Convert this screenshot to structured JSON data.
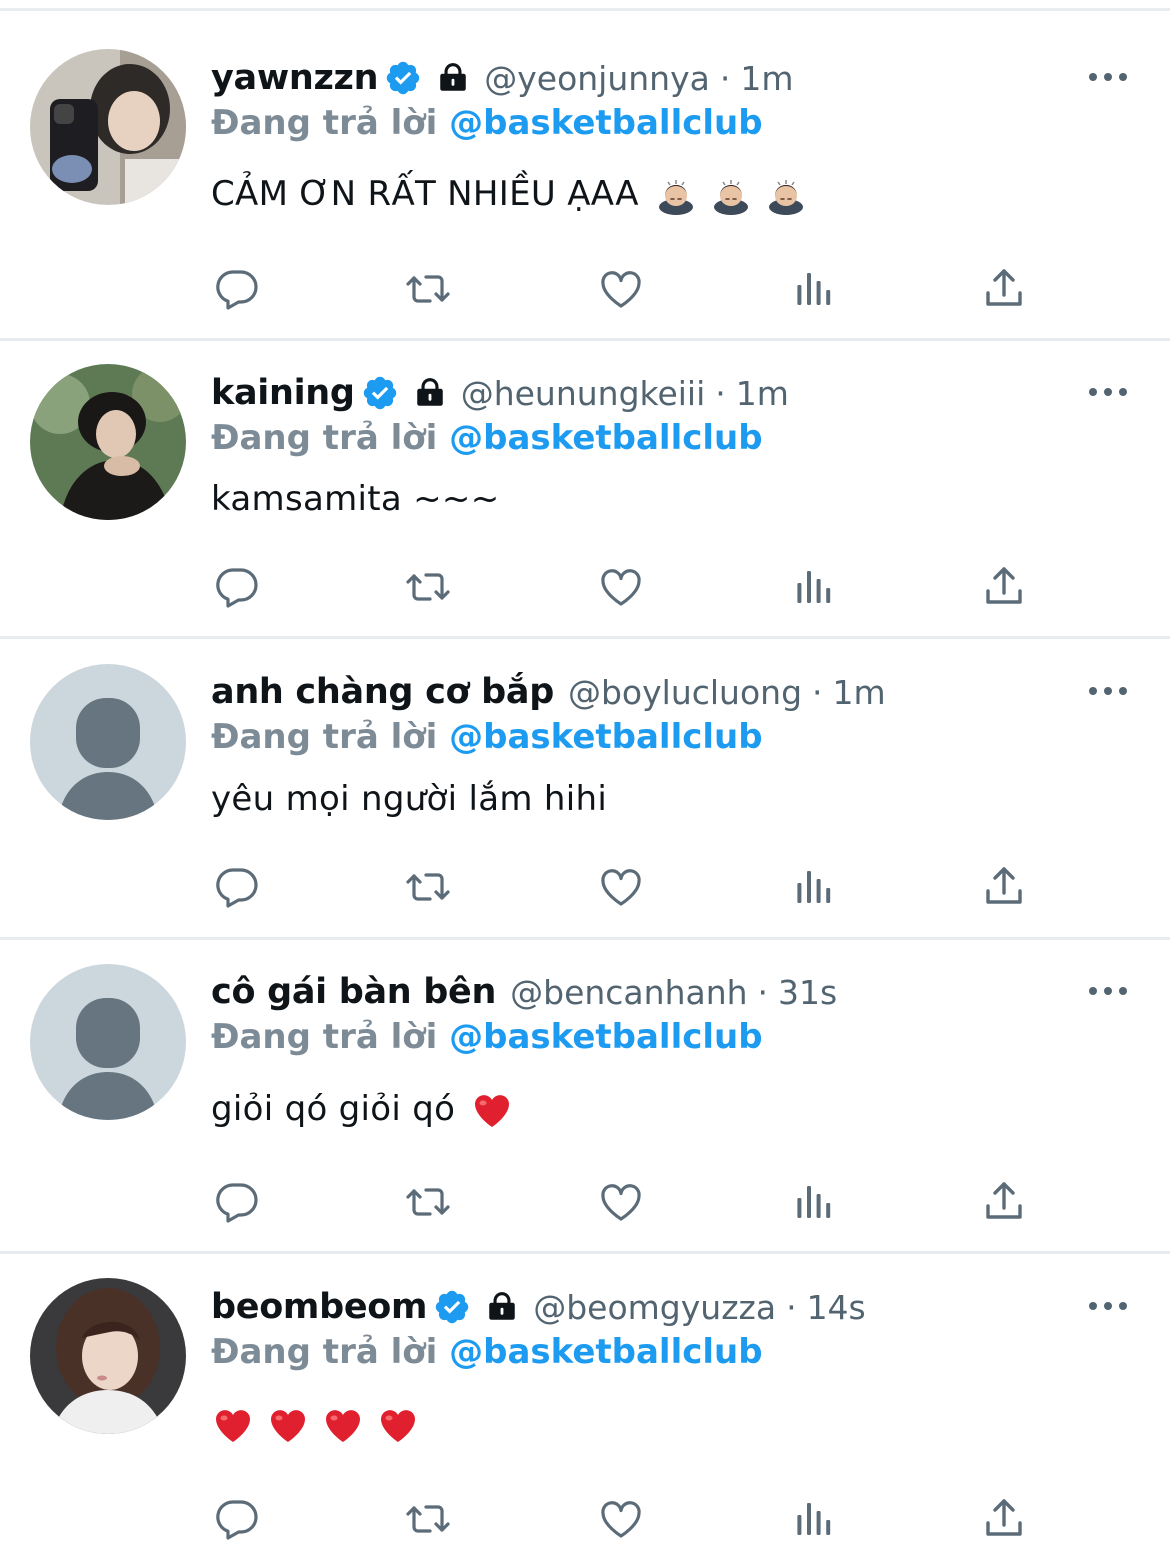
{
  "colors": {
    "verified_blue": "#1d9bf0",
    "mention_blue": "#1d9bf0",
    "muted_gray": "#536471",
    "icon_gray": "#5b6b78",
    "heart_red": "#e0202e",
    "divider": "#e9ecef"
  },
  "replying_prefix": "Đang trả lời",
  "replying_target": "@basketballclub",
  "dot": "·",
  "tweets": [
    {
      "name": "yawnzzn",
      "verified": true,
      "protected": true,
      "handle": "@yeonjunnya",
      "time": "1m",
      "text": "CẢM ƠN RẤT NHIỀU ẠAA",
      "emoji": [
        "person-bowing",
        "person-bowing",
        "person-bowing"
      ]
    },
    {
      "name": "kaining",
      "verified": true,
      "protected": true,
      "handle": "@heunungkeiii",
      "time": "1m",
      "text": "kamsamita ~~~",
      "emoji": []
    },
    {
      "name": "anh chàng cơ bắp",
      "verified": false,
      "protected": false,
      "handle": "@boylucluong",
      "time": "1m",
      "text": "yêu mọi người lắm hihi",
      "emoji": []
    },
    {
      "name": "cô gái bàn bên",
      "verified": false,
      "protected": false,
      "handle": "@bencanhanh",
      "time": "31s",
      "text": "giỏi qó giỏi qó",
      "emoji": [
        "red-heart"
      ]
    },
    {
      "name": "beombeom",
      "verified": true,
      "protected": true,
      "handle": "@beomgyuzza",
      "time": "14s",
      "text": "",
      "emoji": [
        "red-heart",
        "red-heart",
        "red-heart",
        "red-heart"
      ]
    }
  ],
  "action_icons": [
    "reply-icon",
    "retweet-icon",
    "like-icon",
    "views-icon",
    "share-icon"
  ]
}
